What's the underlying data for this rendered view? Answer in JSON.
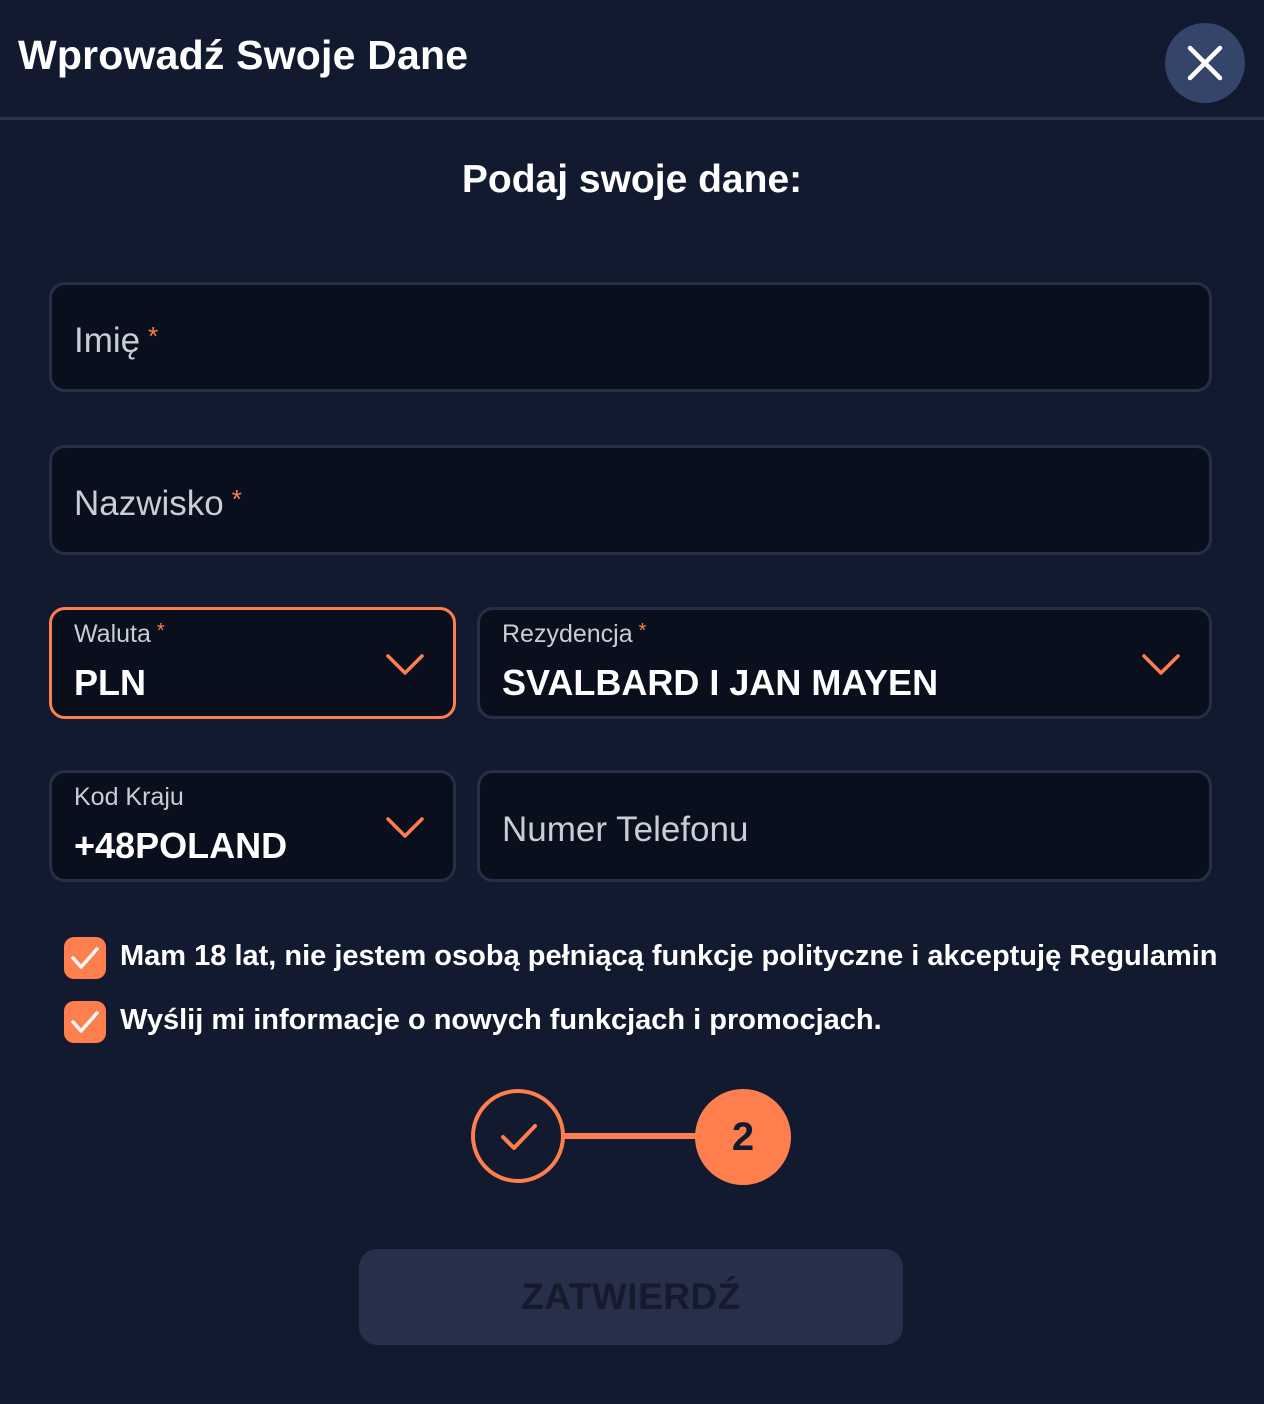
{
  "header": {
    "title": "Wprowadź Swoje Dane",
    "close_icon": "close-icon"
  },
  "form": {
    "subtitle": "Podaj swoje dane:",
    "first_name": {
      "placeholder": "Imię",
      "required_mark": "*",
      "value": ""
    },
    "last_name": {
      "placeholder": "Nazwisko",
      "required_mark": "*",
      "value": ""
    },
    "currency": {
      "label": "Waluta",
      "required_mark": "*",
      "value": "PLN",
      "icon": "chevron-down-icon"
    },
    "residency": {
      "label": "Rezydencja",
      "required_mark": "*",
      "value": "SVALBARD I JAN MAYEN",
      "icon": "chevron-down-icon"
    },
    "country_code": {
      "label": "Kod Kraju",
      "value": "+48POLAND",
      "icon": "chevron-down-icon"
    },
    "phone": {
      "placeholder": "Numer Telefonu",
      "value": ""
    }
  },
  "checkboxes": [
    {
      "label": "Mam 18 lat, nie jestem osobą pełniącą funkcje polityczne i akceptuję Regulamin",
      "checked": true
    },
    {
      "label": "Wyślij mi informacje o nowych funkcjach i promocjach.",
      "checked": true
    }
  ],
  "stepper": {
    "step1_icon": "check-icon",
    "step2_label": "2"
  },
  "submit": {
    "label": "ZATWIERDŹ",
    "disabled": true
  },
  "colors": {
    "background": "#111a2e",
    "field_bg": "#0a0f1d",
    "field_border": "#262f48",
    "accent": "#ff7e4d",
    "close_bg": "#34446a",
    "button_disabled": "#272f4a"
  }
}
